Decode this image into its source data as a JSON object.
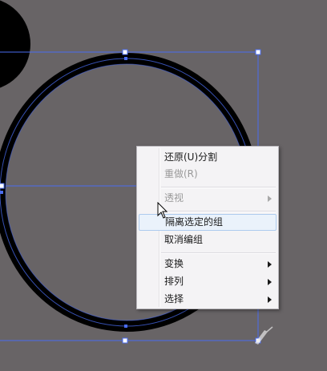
{
  "context_menu": {
    "items": [
      {
        "label": "还原(U)分割",
        "enabled": true,
        "submenu": false
      },
      {
        "label": "重做(R)",
        "enabled": false,
        "submenu": false
      },
      {
        "label": "透视",
        "enabled": false,
        "submenu": true
      },
      {
        "label": "隔离选定的组",
        "enabled": true,
        "submenu": false,
        "highlighted": true
      },
      {
        "label": "取消编组",
        "enabled": true,
        "submenu": false
      },
      {
        "label": "变换",
        "enabled": true,
        "submenu": true
      },
      {
        "label": "排列",
        "enabled": true,
        "submenu": true
      },
      {
        "label": "选择",
        "enabled": true,
        "submenu": true
      }
    ]
  },
  "colors": {
    "canvas_background": "#686466",
    "selection_color": "#4a6cf0",
    "ring_color": "#000000",
    "menu_background": "#f4f3f5",
    "menu_highlight": "#eaf2fb"
  },
  "icons": {
    "cursor": "arrow-cursor-icon",
    "anchor": "anchor-handle-icon"
  }
}
